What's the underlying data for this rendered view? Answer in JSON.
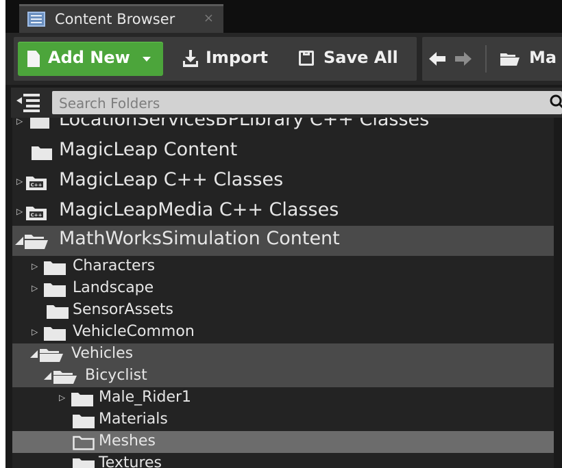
{
  "tab": {
    "title": "Content Browser",
    "close": "×"
  },
  "toolbar": {
    "add_new": "Add New",
    "import": "Import",
    "save_all": "Save All",
    "path_partial": "Ma"
  },
  "search": {
    "placeholder": "Search Folders"
  },
  "tree": {
    "items": [
      {
        "label": "LocationServicesBPLibrary C++ Classes"
      },
      {
        "label": "MagicLeap Content"
      },
      {
        "label": "MagicLeap C++ Classes"
      },
      {
        "label": "MagicLeapMedia C++ Classes"
      },
      {
        "label": "MathWorksSimulation Content"
      },
      {
        "label": "Characters"
      },
      {
        "label": "Landscape"
      },
      {
        "label": "SensorAssets"
      },
      {
        "label": "VehicleCommon"
      },
      {
        "label": "Vehicles"
      },
      {
        "label": "Bicyclist"
      },
      {
        "label": "Male_Rider1"
      },
      {
        "label": "Materials"
      },
      {
        "label": "Meshes"
      },
      {
        "label": "Textures"
      }
    ],
    "cpp_badge": "C++"
  },
  "colors": {
    "add_new_green": "#4ca53b",
    "selection": "#6c6c6c",
    "highlight": "#4a4a4a"
  }
}
